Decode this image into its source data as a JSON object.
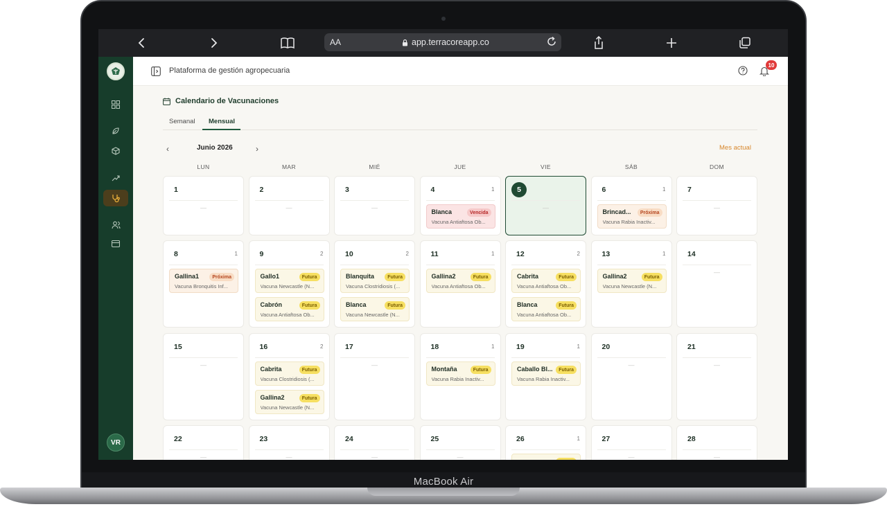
{
  "device": {
    "chin_label": "MacBook Air"
  },
  "browser": {
    "aa_label": "AA",
    "url": "app.terracoreapp.co"
  },
  "header": {
    "title": "Plataforma de gestión agropecuaria",
    "notification_count": "10"
  },
  "sidebar": {
    "items": [
      {
        "icon": "grid-icon"
      },
      {
        "icon": "leaf-icon"
      },
      {
        "icon": "box-icon"
      },
      {
        "icon": "trend-icon"
      },
      {
        "icon": "stethoscope-icon",
        "active": true
      },
      {
        "icon": "users-icon"
      },
      {
        "icon": "card-icon"
      }
    ],
    "avatar_initials": "VR"
  },
  "calendar": {
    "title": "Calendario de Vacunaciones",
    "tabs": [
      "Semanal",
      "Mensual"
    ],
    "active_tab": "Mensual",
    "month_label": "Junio 2026",
    "current_month_label": "Mes actual",
    "prev_glyph": "‹",
    "next_glyph": "›",
    "empty_glyph": "—",
    "weekdays": [
      "LUN",
      "MAR",
      "MIÉ",
      "JUE",
      "VIE",
      "SÁB",
      "DOM"
    ],
    "weeks": [
      [
        {
          "day": "1",
          "count": "",
          "events": []
        },
        {
          "day": "2",
          "count": "",
          "events": []
        },
        {
          "day": "3",
          "count": "",
          "events": []
        },
        {
          "day": "4",
          "count": "1",
          "events": [
            {
              "name": "Blanca",
              "status": "Vencida",
              "desc": "Vacuna Antiaftosa Ob..."
            }
          ]
        },
        {
          "day": "5",
          "count": "",
          "today": true,
          "events": []
        },
        {
          "day": "6",
          "count": "1",
          "events": [
            {
              "name": "Brincad...",
              "status": "Próxima",
              "desc": "Vacuna Rabia Inactiv..."
            }
          ]
        },
        {
          "day": "7",
          "count": "",
          "events": []
        }
      ],
      [
        {
          "day": "8",
          "count": "1",
          "events": [
            {
              "name": "Gallina1",
              "status": "Próxima",
              "desc": "Vacuna Bronquitis Inf..."
            }
          ]
        },
        {
          "day": "9",
          "count": "2",
          "events": [
            {
              "name": "Gallo1",
              "status": "Futura",
              "desc": "Vacuna Newcastle (N..."
            },
            {
              "name": "Cabrón",
              "status": "Futura",
              "desc": "Vacuna Antiaftosa Ob..."
            }
          ]
        },
        {
          "day": "10",
          "count": "2",
          "events": [
            {
              "name": "Blanquita",
              "status": "Futura",
              "desc": "Vacuna Clostridiosis (..."
            },
            {
              "name": "Blanca",
              "status": "Futura",
              "desc": "Vacuna Newcastle (N..."
            }
          ]
        },
        {
          "day": "11",
          "count": "1",
          "events": [
            {
              "name": "Gallina2",
              "status": "Futura",
              "desc": "Vacuna Antiaftosa Ob..."
            }
          ]
        },
        {
          "day": "12",
          "count": "2",
          "events": [
            {
              "name": "Cabrita",
              "status": "Futura",
              "desc": "Vacuna Antiaftosa Ob..."
            },
            {
              "name": "Blanca",
              "status": "Futura",
              "desc": "Vacuna Antiaftosa Ob..."
            }
          ]
        },
        {
          "day": "13",
          "count": "1",
          "events": [
            {
              "name": "Gallina2",
              "status": "Futura",
              "desc": "Vacuna Newcastle (N..."
            }
          ]
        },
        {
          "day": "14",
          "count": "",
          "events": []
        }
      ],
      [
        {
          "day": "15",
          "count": "",
          "events": []
        },
        {
          "day": "16",
          "count": "2",
          "events": [
            {
              "name": "Cabrita",
              "status": "Futura",
              "desc": "Vacuna Clostridiosis (..."
            },
            {
              "name": "Gallina2",
              "status": "Futura",
              "desc": "Vacuna Newcastle (N..."
            }
          ]
        },
        {
          "day": "17",
          "count": "",
          "events": []
        },
        {
          "day": "18",
          "count": "1",
          "events": [
            {
              "name": "Montaña",
              "status": "Futura",
              "desc": "Vacuna Rabia Inactiv..."
            }
          ]
        },
        {
          "day": "19",
          "count": "1",
          "events": [
            {
              "name": "Caballo Bl...",
              "status": "Futura",
              "desc": "Vacuna Rabia Inactiv..."
            }
          ]
        },
        {
          "day": "20",
          "count": "",
          "events": []
        },
        {
          "day": "21",
          "count": "",
          "events": []
        }
      ],
      [
        {
          "day": "22",
          "count": "",
          "events": []
        },
        {
          "day": "23",
          "count": "",
          "events": []
        },
        {
          "day": "24",
          "count": "",
          "events": []
        },
        {
          "day": "25",
          "count": "",
          "events": []
        },
        {
          "day": "26",
          "count": "1",
          "events": [
            {
              "name": "",
              "status": "Futura",
              "desc": ""
            }
          ]
        },
        {
          "day": "27",
          "count": "",
          "events": []
        },
        {
          "day": "28",
          "count": "",
          "events": []
        }
      ]
    ]
  },
  "colors": {
    "sidebar_bg": "#173d2b",
    "accent_green": "#1f4a33",
    "today_bg": "#eaf3ea",
    "mes_actual": "#d7872c",
    "futura_badge": "#f6df61",
    "proxima_badge": "#f8dcc4",
    "vencida_badge": "#f6c9c9"
  }
}
